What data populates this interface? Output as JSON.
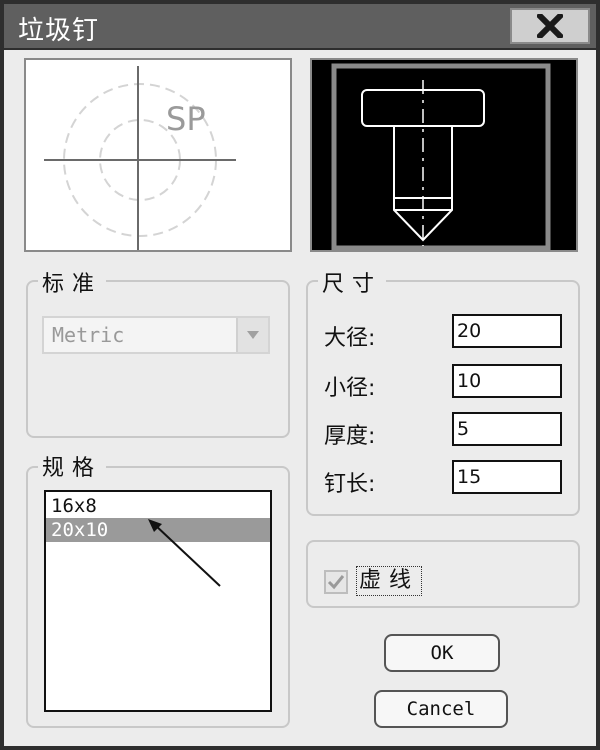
{
  "window": {
    "title": "垃圾钉"
  },
  "icons": {
    "close": "close-x-icon",
    "dropdown": "triangle-down-icon",
    "check": "checkmark-icon",
    "arrow": "arrow-icon"
  },
  "preview_left": {
    "label": "SP"
  },
  "standard": {
    "label": "标准",
    "selected": "Metric"
  },
  "spec": {
    "label": "规格",
    "items": [
      "16x8",
      "20x10"
    ],
    "selected_index": 1
  },
  "dimensions": {
    "label": "尺寸",
    "fields": [
      {
        "label": "大径:",
        "value": "20"
      },
      {
        "label": "小径:",
        "value": "10"
      },
      {
        "label": "厚度:",
        "value": "5"
      },
      {
        "label": "钉长:",
        "value": "15"
      }
    ]
  },
  "dashed": {
    "label": "虚线",
    "checked": true
  },
  "buttons": {
    "ok": "OK",
    "cancel": "Cancel"
  },
  "colors": {
    "title_bar": "#5f5f5f",
    "selection": "#9a9a9a",
    "preview_bg": "#000000"
  }
}
